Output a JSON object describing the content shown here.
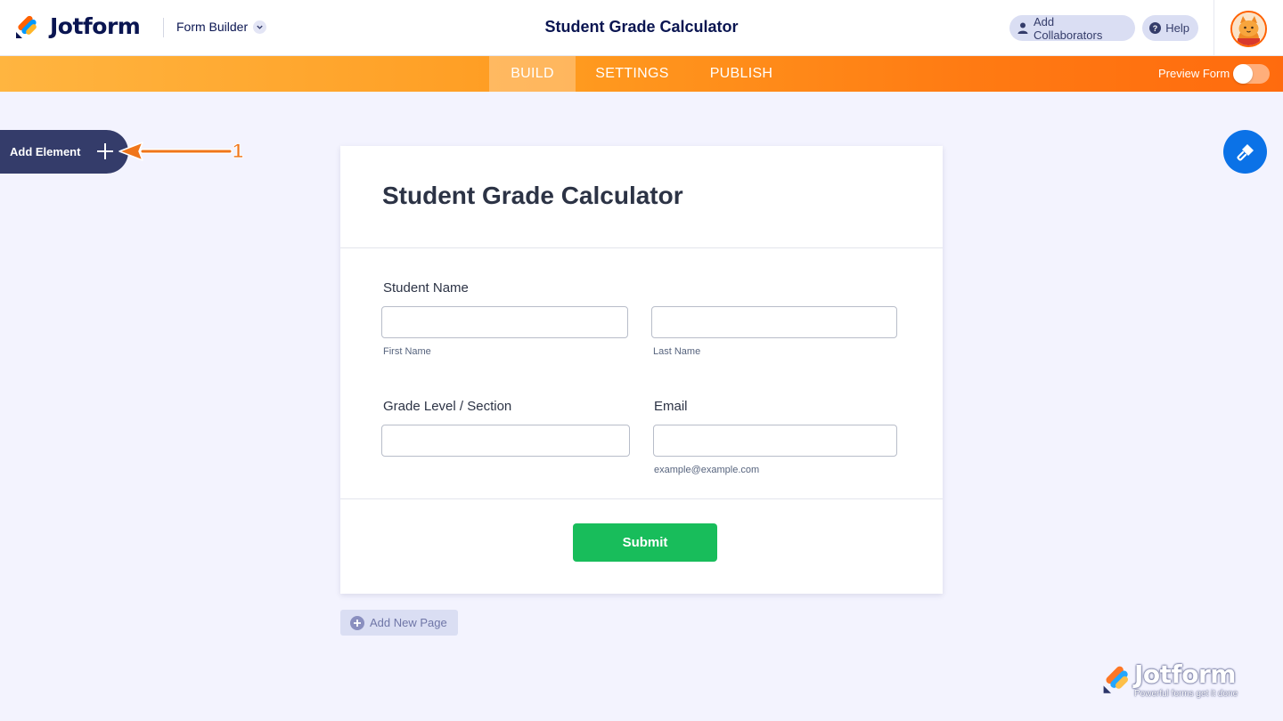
{
  "header": {
    "brand": "Jotform",
    "builder_switch": "Form Builder",
    "form_title": "Student Grade Calculator",
    "add_collaborators": "Add Collaborators",
    "help": "Help"
  },
  "nav": {
    "tabs": [
      {
        "label": "BUILD",
        "active": true
      },
      {
        "label": "SETTINGS",
        "active": false
      },
      {
        "label": "PUBLISH",
        "active": false
      }
    ],
    "preview_label": "Preview Form",
    "preview_on": false
  },
  "sidebar": {
    "add_element": "Add Element",
    "callout_number": "1"
  },
  "form": {
    "title": "Student Grade Calculator",
    "fields": {
      "student_name": {
        "label": "Student Name",
        "first_value": "",
        "last_value": "",
        "first_sublabel": "First Name",
        "last_sublabel": "Last Name"
      },
      "grade_level": {
        "label": "Grade Level / Section",
        "value": ""
      },
      "email": {
        "label": "Email",
        "value": "",
        "sublabel": "example@example.com"
      }
    },
    "submit_label": "Submit"
  },
  "add_new_page": "Add New Page",
  "watermark": {
    "brand": "Jotform",
    "tagline": "Powerful forms get it done"
  },
  "colors": {
    "accent_orange": "#ff6100",
    "navy": "#0a1551",
    "submit_green": "#18bd5b",
    "designer_blue": "#0b72e7"
  },
  "icons": {
    "logo": "jotform-logo-icon",
    "builder_chevron": "chevron-down-icon",
    "collaborators": "user-icon",
    "help": "question-icon",
    "avatar": "cat-avatar-icon",
    "add_element": "plus-icon",
    "form_designer": "paint-roller-icon",
    "add_page": "plus-circle-icon"
  }
}
